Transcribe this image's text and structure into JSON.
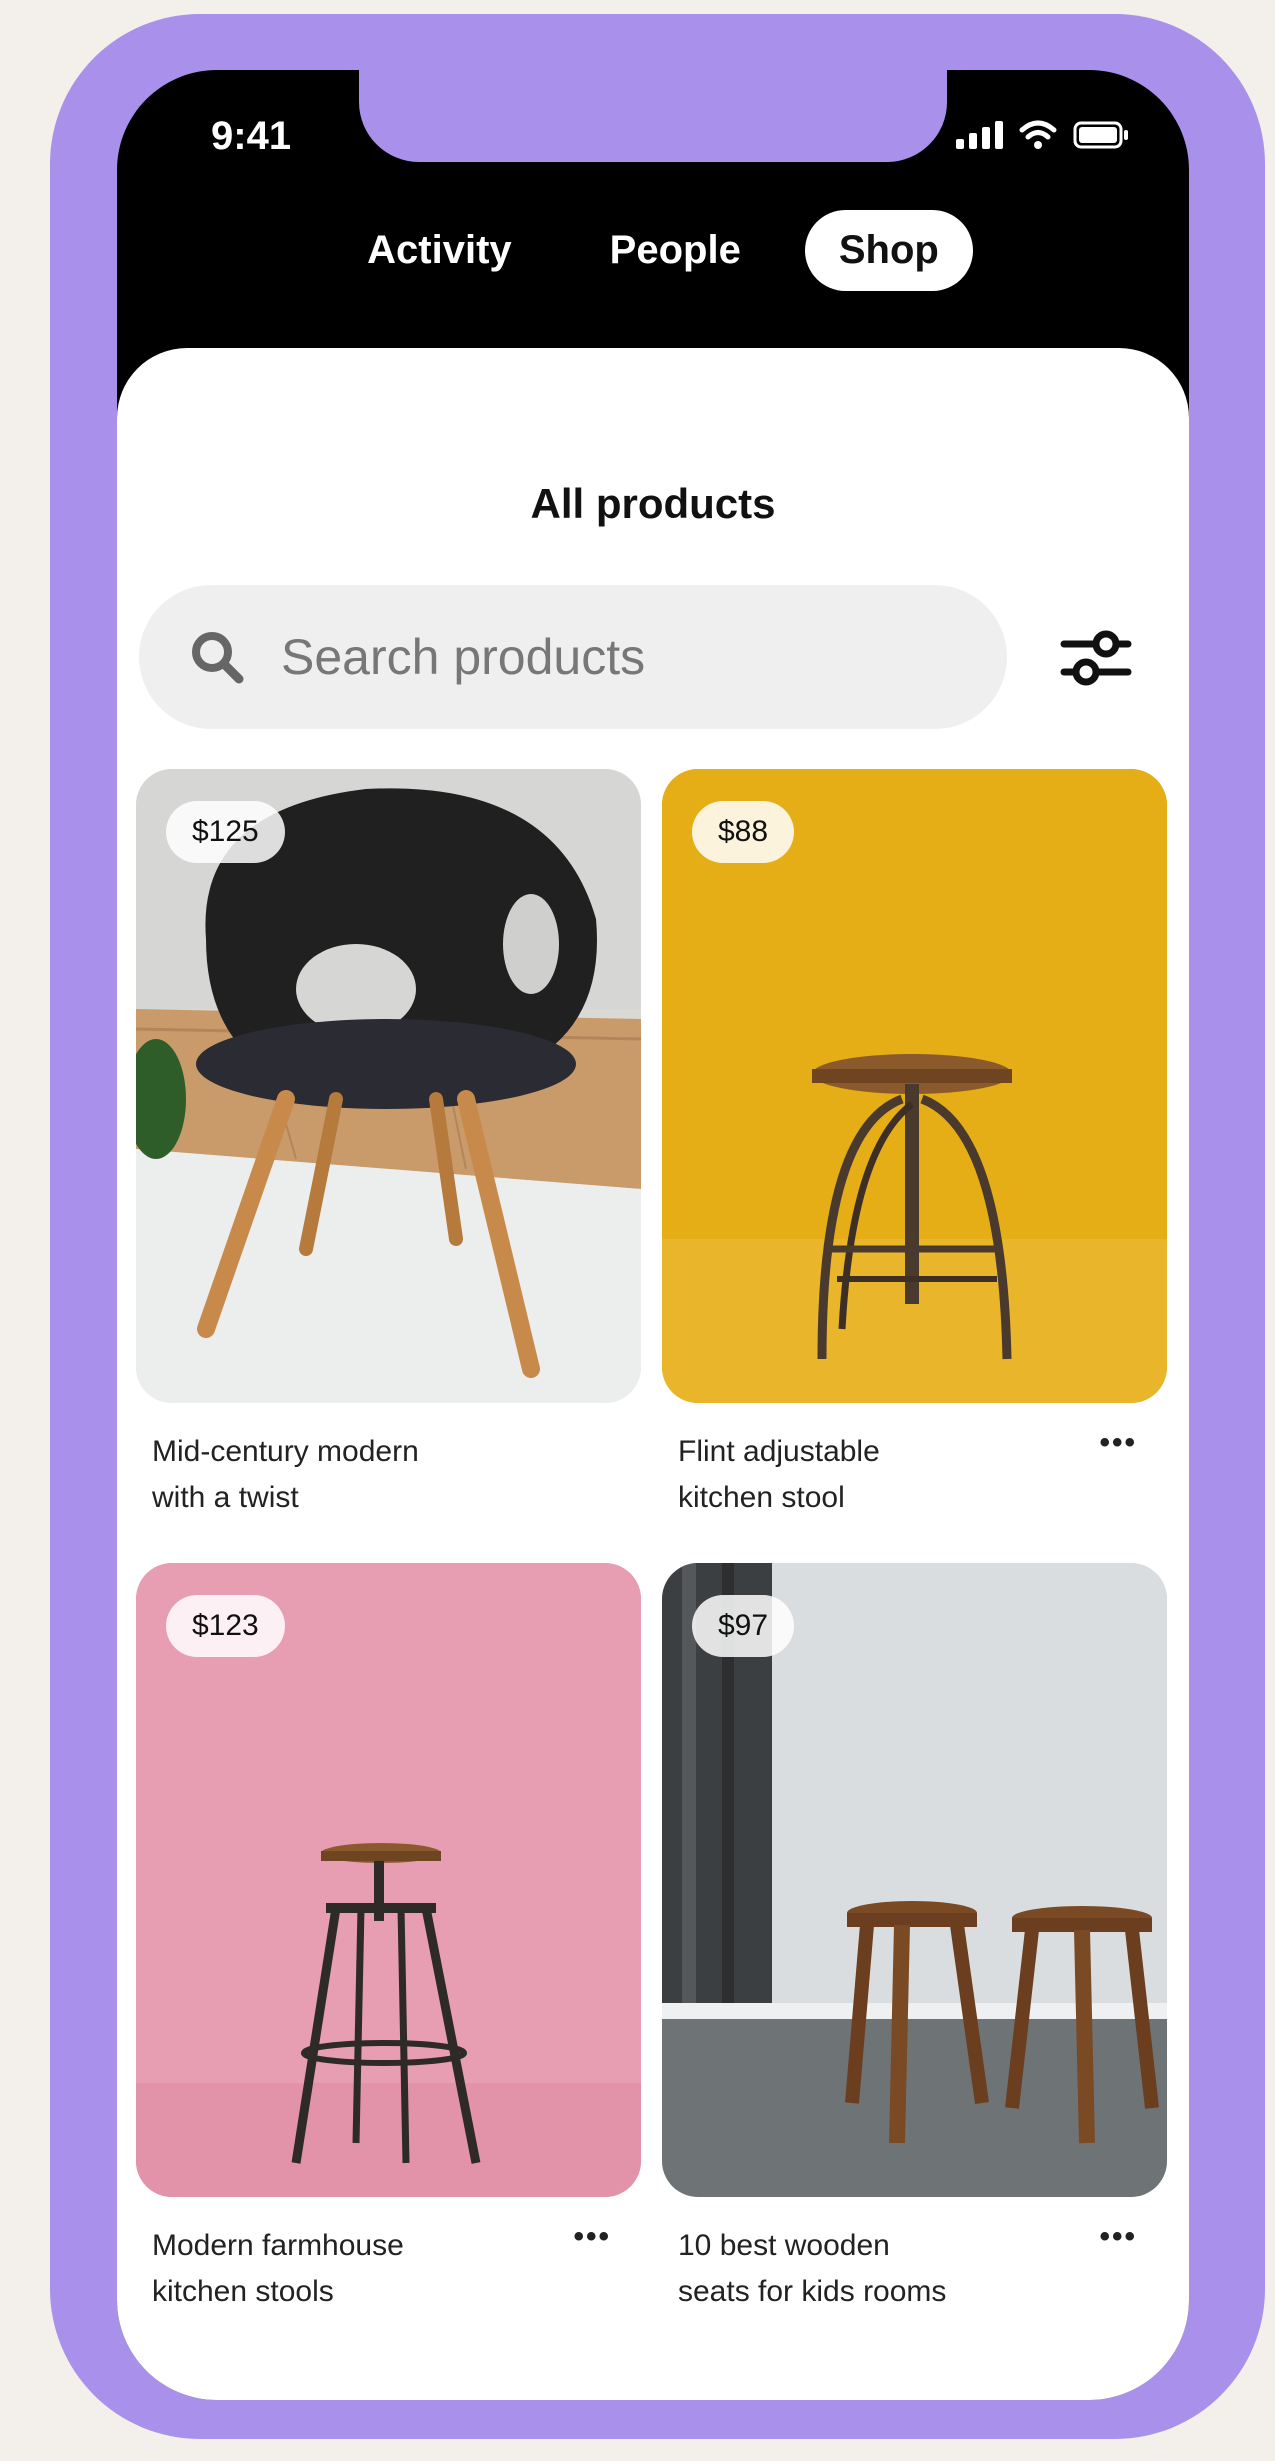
{
  "status": {
    "time": "9:41"
  },
  "tabs": [
    {
      "label": "Activity",
      "active": false
    },
    {
      "label": "People",
      "active": false
    },
    {
      "label": "Shop",
      "active": true
    }
  ],
  "page": {
    "title": "All products"
  },
  "search": {
    "placeholder": "Search products"
  },
  "products": [
    {
      "price": "$125",
      "name_line1": "Mid-century modern",
      "name_line2": "with a twist",
      "has_more": false,
      "more": ""
    },
    {
      "price": "$88",
      "name_line1": "Flint adjustable",
      "name_line2": "kitchen stool",
      "has_more": true,
      "more": "•••"
    },
    {
      "price": "$123",
      "name_line1": "Modern farmhouse",
      "name_line2": "kitchen stools",
      "has_more": true,
      "more": "•••"
    },
    {
      "price": "$97",
      "name_line1": "10 best wooden",
      "name_line2": "seats for kids rooms",
      "has_more": true,
      "more": "•••"
    }
  ],
  "colors": {
    "frame": "#a990ea",
    "card1_bg": "#d9d9d6",
    "card2_bg": "#e5ad16",
    "card3_bg": "#e79db2",
    "card4_bg": "#d9dde0"
  },
  "icons": [
    "signal-icon",
    "wifi-icon",
    "battery-icon",
    "search-icon",
    "filter-icon",
    "more-icon"
  ]
}
